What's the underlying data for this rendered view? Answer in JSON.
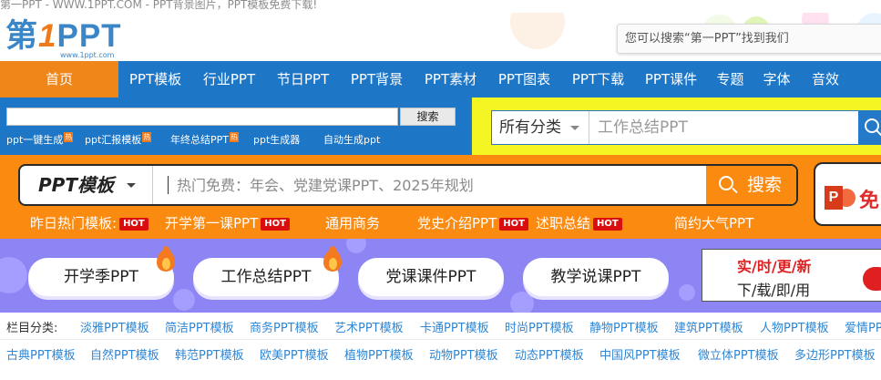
{
  "window": {
    "title": "第一PPT - WWW.1PPT.COM - PPT背景图片，PPT模板免费下载!"
  },
  "header": {
    "logo_text_a": "第",
    "logo_text_one": "1",
    "logo_text_b": "PPT",
    "logo_url": "www.1ppt.com",
    "search_placeholder": "您可以搜索“第一PPT”找到我们"
  },
  "nav": {
    "items": [
      "首页",
      "PPT模板",
      "行业PPT",
      "节日PPT",
      "PPT背景",
      "PPT素材",
      "PPT图表",
      "PPT下载",
      "PPT课件",
      "专题",
      "字体",
      "音效"
    ],
    "active_index": 0
  },
  "mini_search": {
    "button_label": "搜索",
    "links": [
      "ppt一键生成",
      "ppt汇报模板",
      "年终总结PPT",
      "ppt生成器",
      "自动生成ppt"
    ],
    "hot_badge": "热",
    "hot_flags": [
      true,
      true,
      true,
      false,
      false
    ]
  },
  "category_search": {
    "selected": "所有分类",
    "placeholder": "工作总结PPT"
  },
  "big_search": {
    "category": "PPT模板",
    "placeholder": "热门免费：年会、党建党课PPT、2025年规划",
    "button_label": "搜索",
    "card_text": "免"
  },
  "hot_templates": {
    "label": "昨日热门模板:",
    "items": [
      {
        "text": "开学第一课PPT",
        "hot": true
      },
      {
        "text": "通用商务",
        "hot": false
      },
      {
        "text": "党史介绍PPT",
        "hot": true
      },
      {
        "text": "述职总结",
        "hot": true
      },
      {
        "text": "简约大气PPT",
        "hot": false
      }
    ],
    "hot_tag": "HOT"
  },
  "pills": {
    "items": [
      "开学季PPT",
      "工作总结PPT",
      "党课课件PPT",
      "教学说课PPT"
    ],
    "flame_flags": [
      true,
      true,
      false,
      false
    ]
  },
  "promo": {
    "line1": "实/时/更/新",
    "line2": "下/载/即/用"
  },
  "categories": {
    "label": "栏目分类:",
    "row1": [
      "淡雅PPT模板",
      "简洁PPT模板",
      "商务PPT模板",
      "艺术PPT模板",
      "卡通PPT模板",
      "时尚PPT模板",
      "静物PPT模板",
      "建筑PPT模板",
      "人物PPT模板",
      "爱情PPT"
    ],
    "row2": [
      "古典PPT模板",
      "自然PPT模板",
      "韩范PPT模板",
      "欧美PPT模板",
      "植物PPT模板",
      "动物PPT模板",
      "动态PPT模板",
      "中国风PPT模板",
      "微立体PPT模板",
      "多边形PPT模板"
    ]
  },
  "colors": {
    "nav_blue": "#1e76c7",
    "orange": "#fb8a10",
    "yellow": "#f5f524",
    "purple": "#8c85f3",
    "link_blue": "#2f86d4",
    "hot_red": "#d90d0d"
  },
  "icons": {
    "search": "search-icon",
    "caret": "chevron-down-icon",
    "flame": "flame-icon",
    "powerpoint": "powerpoint-icon"
  }
}
